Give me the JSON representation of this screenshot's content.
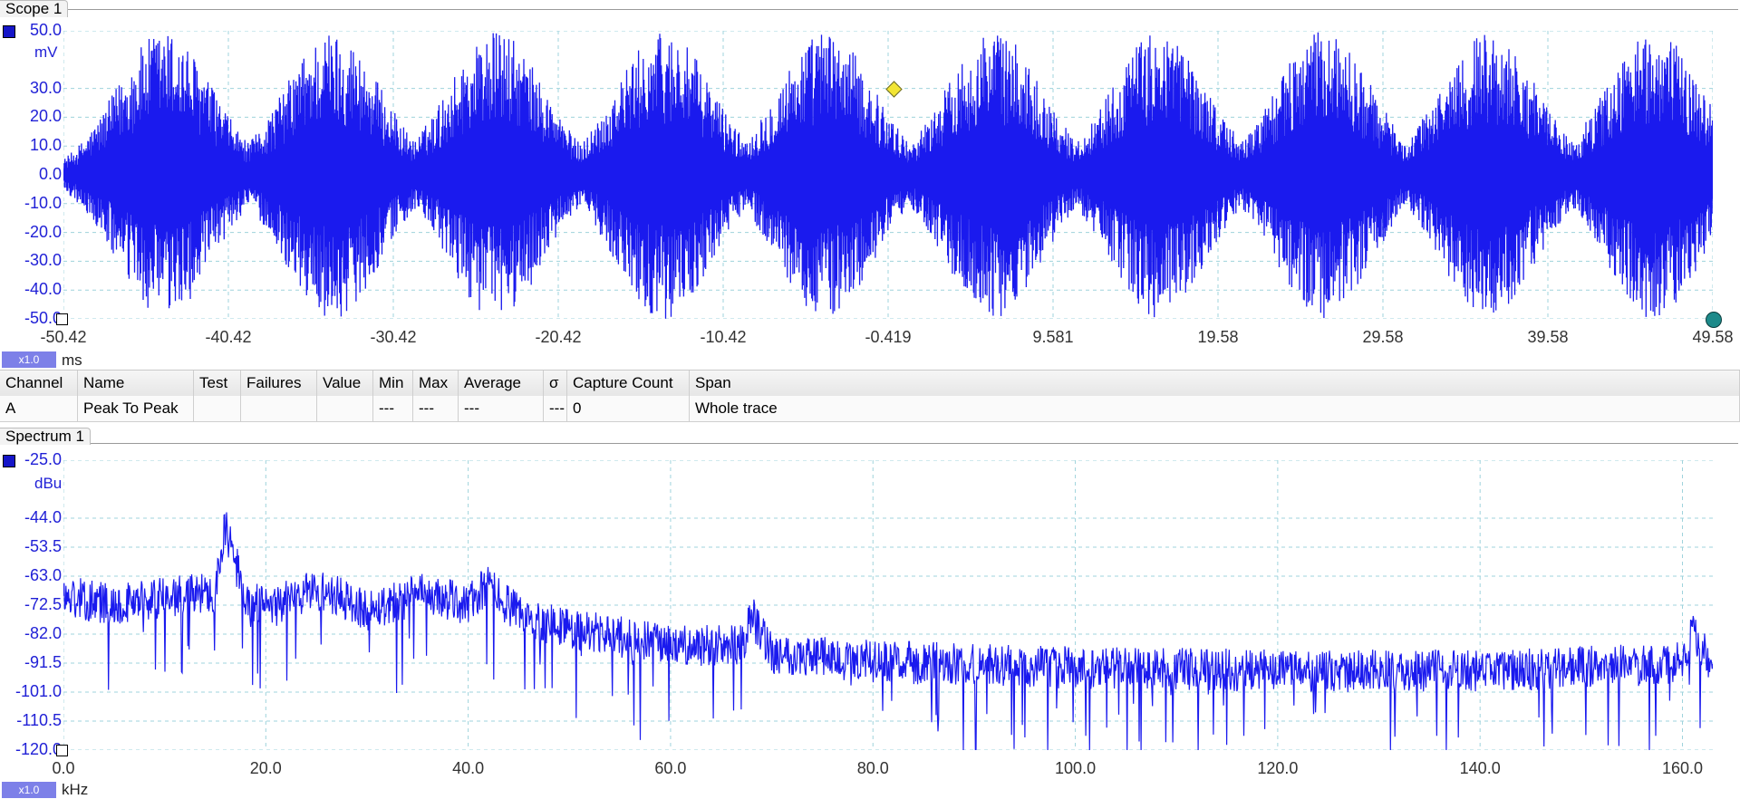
{
  "scope": {
    "title": "Scope 1",
    "y_unit": "mV",
    "x_unit": "ms",
    "zoom": "x1.0",
    "y_ticks": [
      "50.0",
      "30.0",
      "20.0",
      "10.0",
      "0.0",
      "-10.0",
      "-20.0",
      "-30.0",
      "-40.0",
      "-50.0"
    ],
    "x_ticks": [
      "-50.42",
      "-40.42",
      "-30.42",
      "-20.42",
      "-10.42",
      "-0.419",
      "9.581",
      "19.58",
      "29.58",
      "39.58",
      "49.58"
    ],
    "channel_color": "#1515c8",
    "trace_color": "#1a1aee"
  },
  "measurements": {
    "columns": [
      "Channel",
      "Name",
      "Test",
      "Failures",
      "Value",
      "Min",
      "Max",
      "Average",
      "σ",
      "Capture Count",
      "Span"
    ],
    "rows": [
      [
        "A",
        "Peak To Peak",
        "",
        "",
        "",
        "---",
        "---",
        "---",
        "---",
        "0",
        "Whole trace"
      ]
    ]
  },
  "spectrum": {
    "title": "Spectrum 1",
    "y_unit": "dBu",
    "x_unit": "kHz",
    "zoom": "x1.0",
    "y_ticks": [
      "-25.0",
      "-44.0",
      "-53.5",
      "-63.0",
      "-72.5",
      "-82.0",
      "-91.5",
      "-101.0",
      "-110.5",
      "-120.0"
    ],
    "x_ticks": [
      "0.0",
      "20.0",
      "40.0",
      "60.0",
      "80.0",
      "100.0",
      "120.0",
      "140.0",
      "160.0"
    ],
    "trace_color": "#1a1aee"
  },
  "chart_data": [
    {
      "type": "line",
      "name": "scope-waveform",
      "xlabel": "ms",
      "ylabel": "mV",
      "xlim": [
        -50.42,
        49.58
      ],
      "ylim": [
        -50.0,
        50.0
      ],
      "bursts_center_ms": [
        -44.3,
        -34.1,
        -24.2,
        -14.0,
        -4.2,
        6.0,
        16.0,
        26.0,
        36.0,
        46.0
      ],
      "burst_peak_mV": 50,
      "grid": true
    },
    {
      "type": "line",
      "name": "spectrum",
      "xlabel": "kHz",
      "ylabel": "dBu",
      "xlim": [
        0,
        163
      ],
      "ylim": [
        -120.0,
        -25.0
      ],
      "envelope_x_kHz": [
        0,
        5,
        10,
        15,
        16,
        18,
        20,
        25,
        30,
        35,
        40,
        42,
        45,
        50,
        60,
        67,
        68,
        70,
        80,
        100,
        120,
        140,
        158,
        160,
        161,
        163
      ],
      "envelope_y_dBu": [
        -70,
        -72,
        -70,
        -68,
        -47,
        -70,
        -74,
        -67,
        -74,
        -69,
        -72,
        -66,
        -76,
        -80,
        -86,
        -86,
        -76,
        -88,
        -91,
        -93,
        -94,
        -94,
        -92,
        -90,
        -82,
        -93
      ],
      "grid": true
    }
  ]
}
